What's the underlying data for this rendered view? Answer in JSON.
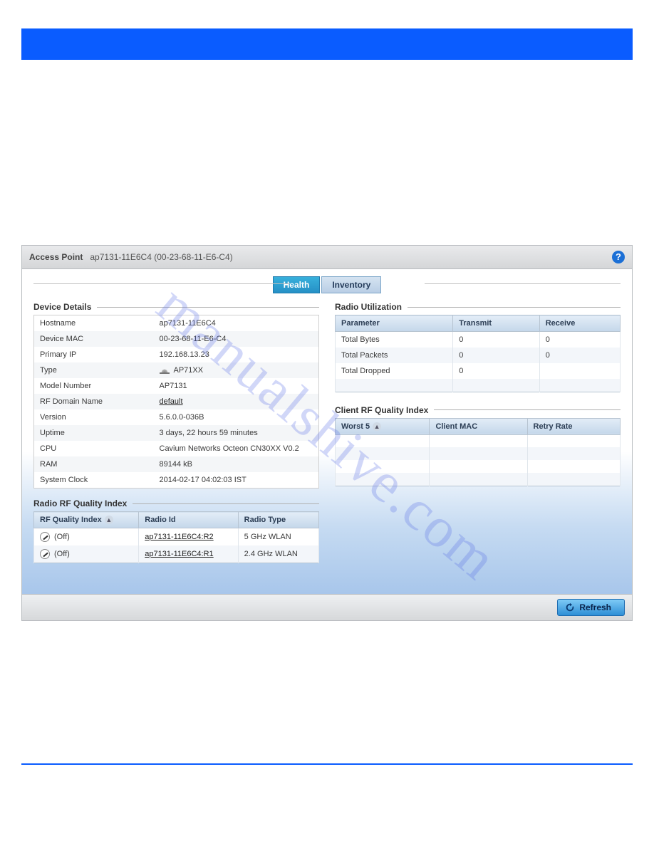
{
  "watermark": "manualshive.com",
  "header": {
    "title_label": "Access Point",
    "title_sub": "ap7131-11E6C4 (00-23-68-11-E6-C4)"
  },
  "tabs": {
    "health": "Health",
    "inventory": "Inventory"
  },
  "sections": {
    "device_details": "Device Details",
    "radio_rf_quality": "Radio RF Quality Index",
    "radio_util": "Radio Utilization",
    "client_rf": "Client RF Quality Index"
  },
  "device_details": {
    "rows": [
      {
        "k": "Hostname",
        "v": "ap7131-11E6C4"
      },
      {
        "k": "Device MAC",
        "v": "00-23-68-11-E6-C4"
      },
      {
        "k": "Primary IP",
        "v": "192.168.13.23"
      },
      {
        "k": "Type",
        "v": "AP71XX",
        "icon": true
      },
      {
        "k": "Model Number",
        "v": "AP7131"
      },
      {
        "k": "RF Domain Name",
        "v": "default",
        "link": true
      },
      {
        "k": "Version",
        "v": "5.6.0.0-036B"
      },
      {
        "k": "Uptime",
        "v": "3 days, 22 hours 59 minutes"
      },
      {
        "k": "CPU",
        "v": "Cavium Networks Octeon CN30XX V0.2"
      },
      {
        "k": "RAM",
        "v": "89144 kB"
      },
      {
        "k": "System Clock",
        "v": "2014-02-17 04:02:03 IST"
      }
    ]
  },
  "radio_rf": {
    "cols": {
      "c1": "RF Quality Index",
      "c2": "Radio Id",
      "c3": "Radio Type"
    },
    "rows": [
      {
        "status": "(Off)",
        "id": "ap7131-11E6C4:R2",
        "type": "5 GHz WLAN"
      },
      {
        "status": "(Off)",
        "id": "ap7131-11E6C4:R1",
        "type": "2.4 GHz WLAN"
      }
    ]
  },
  "radio_util": {
    "cols": {
      "c1": "Parameter",
      "c2": "Transmit",
      "c3": "Receive"
    },
    "rows": [
      {
        "p": "Total Bytes",
        "t": "0",
        "r": "0"
      },
      {
        "p": "Total Packets",
        "t": "0",
        "r": "0"
      },
      {
        "p": "Total Dropped",
        "t": "0",
        "r": ""
      }
    ]
  },
  "client_rf": {
    "cols": {
      "c1": "Worst 5",
      "c2": "Client MAC",
      "c3": "Retry Rate"
    }
  },
  "buttons": {
    "refresh": "Refresh"
  }
}
